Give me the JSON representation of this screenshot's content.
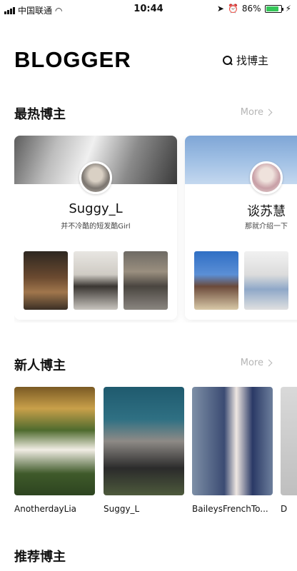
{
  "status_bar": {
    "carrier": "中国联通",
    "time": "10:44",
    "battery": "86%",
    "battery_level": 0.86
  },
  "header": {
    "title": "BLOGGER",
    "find_label": "找博主"
  },
  "hot_section": {
    "title": "最热博主",
    "more": "More",
    "cards": [
      {
        "name": "Suggy_L",
        "desc": "并不冷酷的短发酷Girl"
      },
      {
        "name": "谈苏慧",
        "desc": "那就介绍一下"
      }
    ]
  },
  "new_section": {
    "title": "新人博主",
    "more": "More",
    "items": [
      {
        "name": "AnotherdayLia"
      },
      {
        "name": "Suggy_L"
      },
      {
        "name": "BaileysFrenchTo..."
      },
      {
        "name": "D"
      }
    ]
  },
  "recommend_section": {
    "title": "推荐博主"
  },
  "colors": {
    "more": "#b5b5b5",
    "battery": "#35c759"
  }
}
